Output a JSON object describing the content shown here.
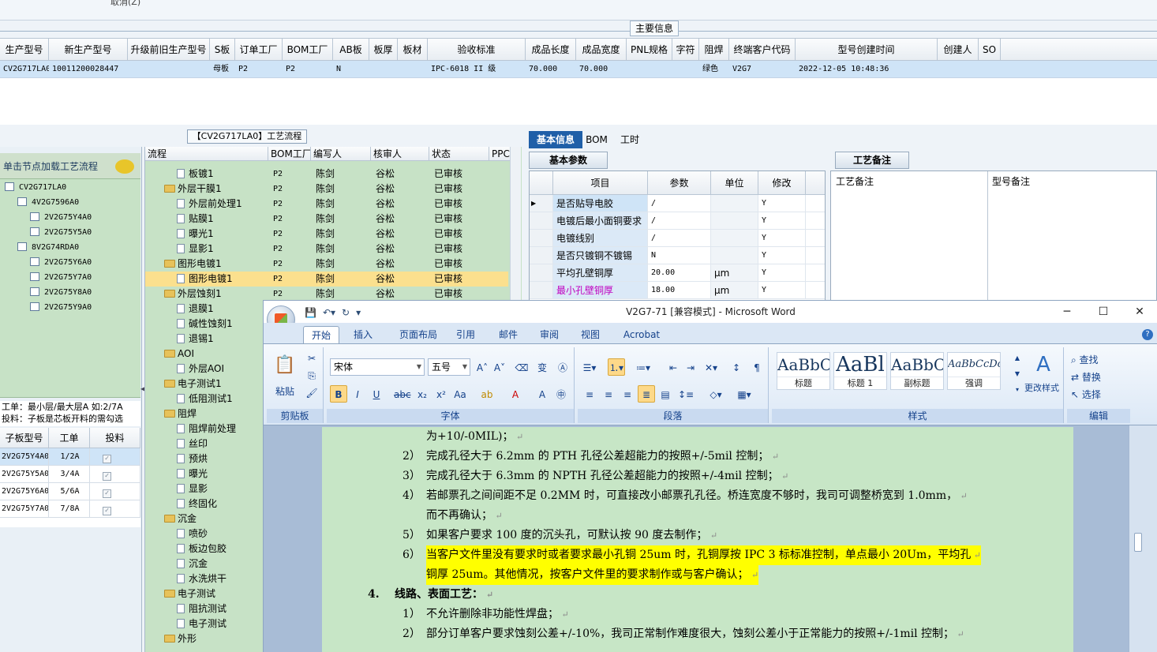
{
  "top": {
    "cut_text": "取消(Z)",
    "main_info_title": "主要信息",
    "columns": [
      "生产型号",
      "新生产型号",
      "升级前旧生产型号",
      "S板",
      "订单工厂",
      "BOM工厂",
      "AB板",
      "板厚",
      "板材",
      "验收标准",
      "成品长度",
      "成品宽度",
      "PNL规格",
      "字符",
      "阻焊",
      "终端客户代码",
      "型号创建时间",
      "创建人",
      "SO"
    ],
    "row": [
      "CV2G717LA0",
      "10011200028447",
      "",
      "母板",
      "P2",
      "P2",
      "N",
      "",
      "",
      "IPC-6018 II 级",
      "70.000",
      "70.000",
      "",
      "",
      "绿色",
      "V2G7",
      "2022-12-05 10:48:36",
      "",
      ""
    ]
  },
  "process": {
    "title": "【CV2G717LA0】工艺流程",
    "columns": [
      "流程",
      "BOM工厂",
      "编写人",
      "核审人",
      "状态",
      "PPC"
    ],
    "rows": [
      {
        "name": "板镀1",
        "level": 2,
        "factory": "P2",
        "writer": "陈剑",
        "reviewer": "谷松",
        "status": "已审核"
      },
      {
        "name": "外层干膜1",
        "level": 1,
        "factory": "P2",
        "writer": "陈剑",
        "reviewer": "谷松",
        "status": "已审核"
      },
      {
        "name": "外层前处理1",
        "level": 2,
        "factory": "P2",
        "writer": "陈剑",
        "reviewer": "谷松",
        "status": "已审核"
      },
      {
        "name": "贴膜1",
        "level": 2,
        "factory": "P2",
        "writer": "陈剑",
        "reviewer": "谷松",
        "status": "已审核"
      },
      {
        "name": "曝光1",
        "level": 2,
        "factory": "P2",
        "writer": "陈剑",
        "reviewer": "谷松",
        "status": "已审核"
      },
      {
        "name": "显影1",
        "level": 2,
        "factory": "P2",
        "writer": "陈剑",
        "reviewer": "谷松",
        "status": "已审核"
      },
      {
        "name": "图形电镀1",
        "level": 1,
        "factory": "P2",
        "writer": "陈剑",
        "reviewer": "谷松",
        "status": "已审核"
      },
      {
        "name": "图形电镀1",
        "level": 2,
        "factory": "P2",
        "writer": "陈剑",
        "reviewer": "谷松",
        "status": "已审核",
        "selected": true
      },
      {
        "name": "外层蚀刻1",
        "level": 1,
        "factory": "P2",
        "writer": "陈剑",
        "reviewer": "谷松",
        "status": "已审核"
      },
      {
        "name": "退膜1",
        "level": 2
      },
      {
        "name": "碱性蚀刻1",
        "level": 2
      },
      {
        "name": "退锡1",
        "level": 2
      },
      {
        "name": "AOI",
        "level": 1
      },
      {
        "name": "外层AOI",
        "level": 2
      },
      {
        "name": "电子测试1",
        "level": 1
      },
      {
        "name": "低阻测试1",
        "level": 2
      },
      {
        "name": "阻焊",
        "level": 1
      },
      {
        "name": "阻焊前处理",
        "level": 2
      },
      {
        "name": "丝印",
        "level": 2
      },
      {
        "name": "预烘",
        "level": 2
      },
      {
        "name": "曝光",
        "level": 2
      },
      {
        "name": "显影",
        "level": 2
      },
      {
        "name": "终固化",
        "level": 2
      },
      {
        "name": "沉金",
        "level": 1
      },
      {
        "name": "喷砂",
        "level": 2
      },
      {
        "name": "板边包胶",
        "level": 2
      },
      {
        "name": "沉金",
        "level": 2
      },
      {
        "name": "水洗烘干",
        "level": 2
      },
      {
        "name": "电子测试",
        "level": 1
      },
      {
        "name": "阻抗测试",
        "level": 2
      },
      {
        "name": "电子测试",
        "level": 2
      },
      {
        "name": "外形",
        "level": 1
      }
    ]
  },
  "left": {
    "hint": "单击节点加载工艺流程",
    "tree": [
      {
        "label": "CV2G717LA0",
        "level": 0
      },
      {
        "label": "4V2G7596A0",
        "level": 1
      },
      {
        "label": "2V2G75Y4A0",
        "level": 2
      },
      {
        "label": "2V2G75Y5A0",
        "level": 2
      },
      {
        "label": "8V2G74RDA0",
        "level": 1
      },
      {
        "label": "2V2G75Y6A0",
        "level": 2
      },
      {
        "label": "2V2G75Y7A0",
        "level": 2
      },
      {
        "label": "2V2G75Y8A0",
        "level": 2
      },
      {
        "label": "2V2G75Y9A0",
        "level": 2
      }
    ],
    "note_line1": "工单：最小层/最大层A 如:2/7A",
    "note_line2": "投料：子板是芯板开料的需勾选",
    "sub_columns": [
      "子板型号",
      "工单",
      "投料"
    ],
    "sub_rows": [
      {
        "model": "2V2G75Y4A0",
        "order": "1/2A",
        "selected": true
      },
      {
        "model": "2V2G75Y5A0",
        "order": "3/4A"
      },
      {
        "model": "2V2G75Y6A0",
        "order": "5/6A"
      },
      {
        "model": "2V2G75Y7A0",
        "order": "7/8A"
      }
    ]
  },
  "right": {
    "tabs": [
      "基本信息",
      "BOM",
      "工时"
    ],
    "params_tab": "基本参数",
    "param_columns": [
      "项目",
      "参数",
      "单位",
      "修改"
    ],
    "params": [
      {
        "key": "是否贴导电胶",
        "value": "/",
        "unit": "",
        "mod": "Y"
      },
      {
        "key": "电镀后最小面铜要求",
        "value": "/",
        "unit": "",
        "mod": "Y"
      },
      {
        "key": "电镀线别",
        "value": "/",
        "unit": "",
        "mod": "Y"
      },
      {
        "key": "是否只镀铜不镀锡",
        "value": "N",
        "unit": "",
        "mod": "Y"
      },
      {
        "key": "平均孔壁铜厚",
        "value": "20.00",
        "unit": "μm",
        "mod": "Y"
      },
      {
        "key": "最小孔壁铜厚",
        "value": "18.00",
        "unit": "μm",
        "mod": "Y",
        "color": "#c000c0"
      }
    ],
    "notes_tab": "工艺备注",
    "process_note_label": "工艺备注",
    "model_note_label": "型号备注"
  },
  "word": {
    "caption": "V2G7-71 [兼容模式] - Microsoft Word",
    "tabs": [
      "开始",
      "插入",
      "页面布局",
      "引用",
      "邮件",
      "审阅",
      "视图",
      "Acrobat"
    ],
    "paste_label": "粘贴",
    "font_name": "宋体",
    "font_size": "五号",
    "styles": [
      {
        "sample": "AaBbC",
        "name": "标题",
        "size": "20px"
      },
      {
        "sample": "AaBl",
        "name": "标题 1",
        "size": "26px"
      },
      {
        "sample": "AaBbC",
        "name": "副标题",
        "size": "20px"
      },
      {
        "sample": "AaBbCcDc",
        "name": "强调",
        "size": "13px",
        "italic": true
      }
    ],
    "change_styles": "更改样式",
    "find": "查找",
    "replace": "替换",
    "select": "选择",
    "groups": [
      "剪贴板",
      "字体",
      "段落",
      "样式",
      "编辑"
    ],
    "doc": [
      {
        "num": "",
        "text": "为+10/-0MIL)；",
        "cont": true
      },
      {
        "num": "2）",
        "text": "完成孔径大于 6.2mm 的 PTH 孔径公差超能力的按照+/-5mil 控制；"
      },
      {
        "num": "3）",
        "text": "完成孔径大于 6.3mm 的 NPTH 孔径公差超能力的按照+/-4mil 控制；"
      },
      {
        "num": "4）",
        "text": "若邮票孔之间间距不足 0.2MM 时，可直接改小邮票孔孔径。桥连宽度不够时，我司可调整桥宽到 1.0mm，"
      },
      {
        "num": "",
        "text": "而不再确认；",
        "cont": true
      },
      {
        "num": "5）",
        "text": "如果客户要求 100 度的沉头孔，可默认按 90 度去制作；"
      },
      {
        "num": "6）",
        "text": "当客户文件里没有要求时或者要求最小孔铜 25um 时，孔铜厚按 IPC 3 标标准控制，单点最小 20Um，平均孔",
        "hl": true
      },
      {
        "num": "",
        "text": "铜厚 25um。其他情况，按客户文件里的要求制作或与客户确认；",
        "cont": true,
        "hl": true
      },
      {
        "num": "4.",
        "text": "线路、表面工艺：",
        "heading": true
      },
      {
        "num": "1）",
        "text": "不允许删除非功能性焊盘；"
      },
      {
        "num": "2）",
        "text": "部分订单客户要求蚀刻公差+/-10%，我司正常制作难度很大，蚀刻公差小于正常能力的按照+/-1mil 控制；"
      }
    ]
  }
}
